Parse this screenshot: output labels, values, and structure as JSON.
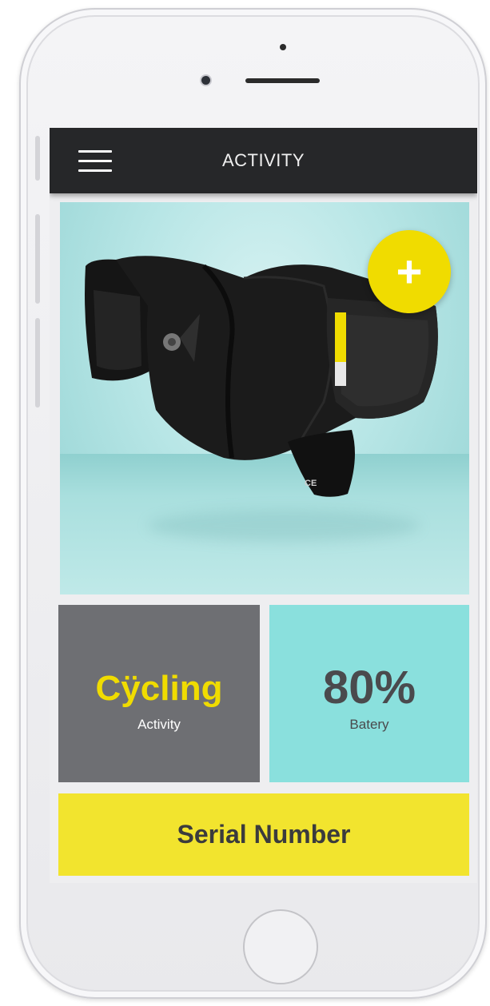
{
  "header": {
    "title": "ACTIVITY"
  },
  "hero": {
    "image": "airbag-collar-product-photo",
    "add_button_label": "+"
  },
  "stats": {
    "activity": {
      "value": "Cÿcling",
      "label": "Activity"
    },
    "battery": {
      "value": "80%",
      "label": "Batery"
    }
  },
  "serial": {
    "label": "Serial Number"
  },
  "icons": {
    "menu": "hamburger-menu-icon",
    "add": "plus-icon"
  },
  "colors": {
    "accent_yellow": "#f0dc00",
    "topbar": "#262729",
    "activity_tile": "#6e6f73",
    "battery_tile": "#8ae0dd",
    "serial_bar": "#f2e42e"
  }
}
